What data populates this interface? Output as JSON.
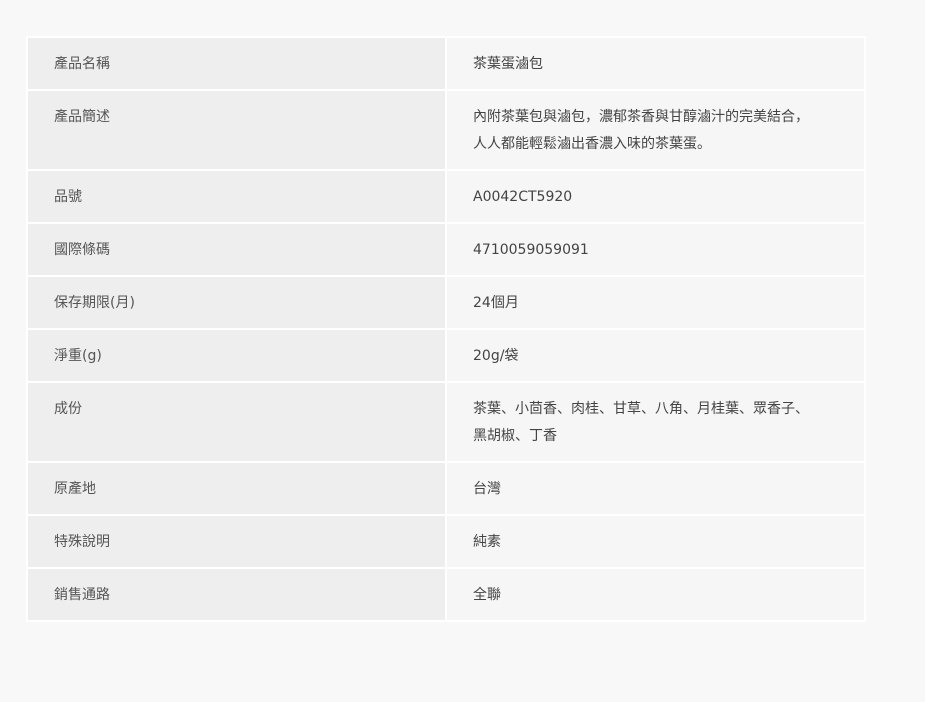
{
  "spec_table": {
    "rows": [
      {
        "label": "產品名稱",
        "value": "茶葉蛋滷包"
      },
      {
        "label": "產品簡述",
        "value_lines": [
          "內附茶葉包與滷包，濃郁茶香與甘醇滷汁的完美結合，",
          "人人都能輕鬆滷出香濃入味的茶葉蛋。"
        ]
      },
      {
        "label": "品號",
        "value": "A0042CT5920"
      },
      {
        "label": "國際條碼",
        "value": "4710059059091"
      },
      {
        "label": "保存期限(月)",
        "value": "24個月"
      },
      {
        "label": "淨重(g)",
        "value": "20g/袋"
      },
      {
        "label": "成份",
        "value_lines": [
          "茶葉、小茴香、肉桂、甘草、八角、月桂葉、眾香子、",
          "黑胡椒、丁香"
        ]
      },
      {
        "label": "原產地",
        "value": "台灣"
      },
      {
        "label": "特殊說明",
        "value": "純素"
      },
      {
        "label": "銷售通路",
        "value": "全聯"
      }
    ]
  }
}
